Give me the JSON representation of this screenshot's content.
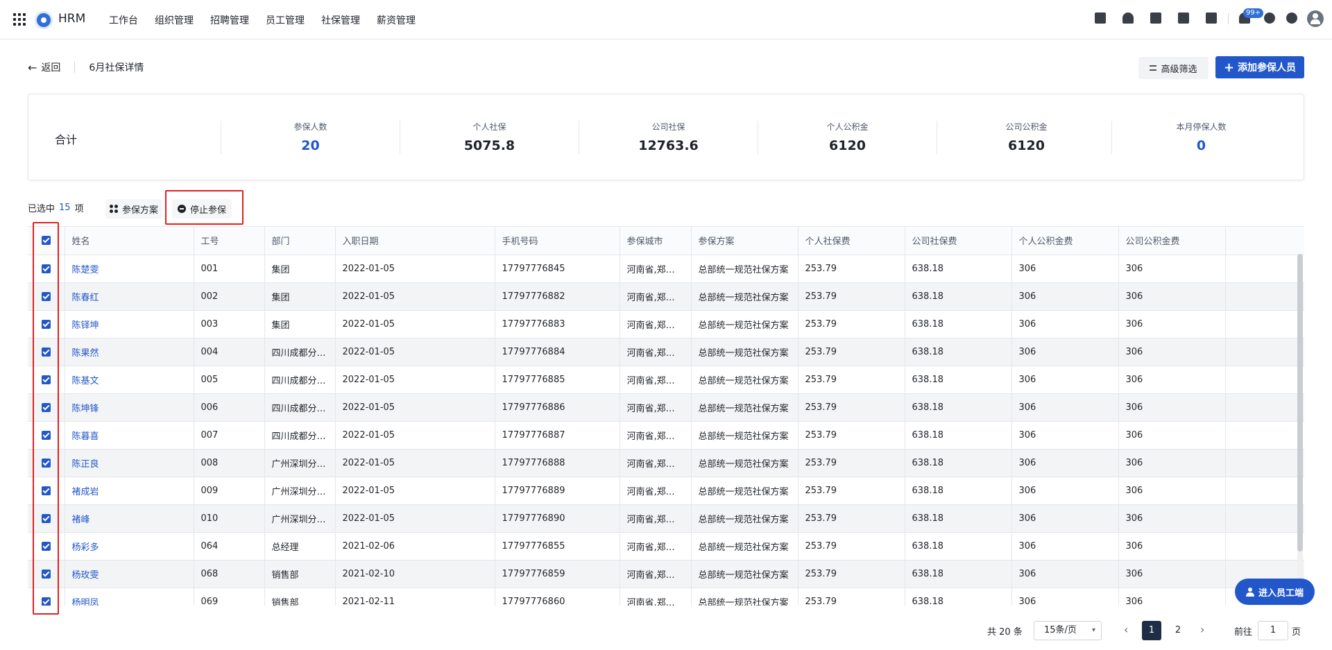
{
  "header": {
    "app_name": "HRM",
    "nav": [
      "工作台",
      "组织管理",
      "招聘管理",
      "员工管理",
      "社保管理",
      "薪资管理"
    ],
    "icons": [
      "calendar-check-icon",
      "contact-icon",
      "document-icon",
      "phone-icon",
      "calendar-icon",
      "bell-icon",
      "help-icon",
      "gear-icon",
      "avatar"
    ],
    "notification_badge": "99+"
  },
  "page": {
    "back_label": "返回",
    "title": "6月社保详情",
    "filter_button": "高级筛选",
    "add_button": "添加参保人员"
  },
  "summary": {
    "label": "合计",
    "items": [
      {
        "title": "参保人数",
        "value": "20"
      },
      {
        "title": "个人社保",
        "value": "5075.8"
      },
      {
        "title": "公司社保",
        "value": "12763.6"
      },
      {
        "title": "个人公积金",
        "value": "6120"
      },
      {
        "title": "公司公积金",
        "value": "6120"
      },
      {
        "title": "本月停保人数",
        "value": "0"
      }
    ]
  },
  "selection": {
    "prefix": "已选中",
    "count": "15",
    "suffix": "项",
    "plan_button": "参保方案",
    "stop_button": "停止参保"
  },
  "table": {
    "columns": [
      "姓名",
      "工号",
      "部门",
      "入职日期",
      "手机号码",
      "参保城市",
      "参保方案",
      "个人社保费",
      "公司社保费",
      "个人公积金费",
      "公司公积金费"
    ],
    "rows": [
      [
        "陈楚雯",
        "001",
        "集团",
        "2022-01-05",
        "17797776845",
        "河南省,郑州市",
        "总部统一规范社保方案",
        "253.79",
        "638.18",
        "306",
        "306"
      ],
      [
        "陈春红",
        "002",
        "集团",
        "2022-01-05",
        "17797776882",
        "河南省,郑州市",
        "总部统一规范社保方案",
        "253.79",
        "638.18",
        "306",
        "306"
      ],
      [
        "陈铎坤",
        "003",
        "集团",
        "2022-01-05",
        "17797776883",
        "河南省,郑州市",
        "总部统一规范社保方案",
        "253.79",
        "638.18",
        "306",
        "306"
      ],
      [
        "陈果然",
        "004",
        "四川成都分公司",
        "2022-01-05",
        "17797776884",
        "河南省,郑州市",
        "总部统一规范社保方案",
        "253.79",
        "638.18",
        "306",
        "306"
      ],
      [
        "陈基文",
        "005",
        "四川成都分公司",
        "2022-01-05",
        "17797776885",
        "河南省,郑州市",
        "总部统一规范社保方案",
        "253.79",
        "638.18",
        "306",
        "306"
      ],
      [
        "陈坤锋",
        "006",
        "四川成都分公司",
        "2022-01-05",
        "17797776886",
        "河南省,郑州市",
        "总部统一规范社保方案",
        "253.79",
        "638.18",
        "306",
        "306"
      ],
      [
        "陈暮喜",
        "007",
        "四川成都分公司",
        "2022-01-05",
        "17797776887",
        "河南省,郑州市",
        "总部统一规范社保方案",
        "253.79",
        "638.18",
        "306",
        "306"
      ],
      [
        "陈正良",
        "008",
        "广州深圳分公司",
        "2022-01-05",
        "17797776888",
        "河南省,郑州市",
        "总部统一规范社保方案",
        "253.79",
        "638.18",
        "306",
        "306"
      ],
      [
        "褚成岩",
        "009",
        "广州深圳分公司",
        "2022-01-05",
        "17797776889",
        "河南省,郑州市",
        "总部统一规范社保方案",
        "253.79",
        "638.18",
        "306",
        "306"
      ],
      [
        "褚峰",
        "010",
        "广州深圳分公司",
        "2022-01-05",
        "17797776890",
        "河南省,郑州市",
        "总部统一规范社保方案",
        "253.79",
        "638.18",
        "306",
        "306"
      ],
      [
        "杨彩多",
        "064",
        "总经理",
        "2021-02-06",
        "17797776855",
        "河南省,郑州市",
        "总部统一规范社保方案",
        "253.79",
        "638.18",
        "306",
        "306"
      ],
      [
        "杨玫雯",
        "068",
        "销售部",
        "2021-02-10",
        "17797776859",
        "河南省,郑州市",
        "总部统一规范社保方案",
        "253.79",
        "638.18",
        "306",
        "306"
      ],
      [
        "杨明凤",
        "069",
        "销售部",
        "2021-02-11",
        "17797776860",
        "河南省,郑州市",
        "总部统一规范社保方案",
        "253.79",
        "638.18",
        "306",
        "306"
      ]
    ]
  },
  "pagination": {
    "total": "共 20 条",
    "page_size": "15条/页",
    "pages": [
      "1",
      "2"
    ],
    "current": "1",
    "goto_label": "前往",
    "goto_value": "1",
    "goto_unit": "页"
  },
  "float_button": "进入员工端",
  "colors": {
    "primary": "#2257c9",
    "highlight": "#e02020"
  }
}
